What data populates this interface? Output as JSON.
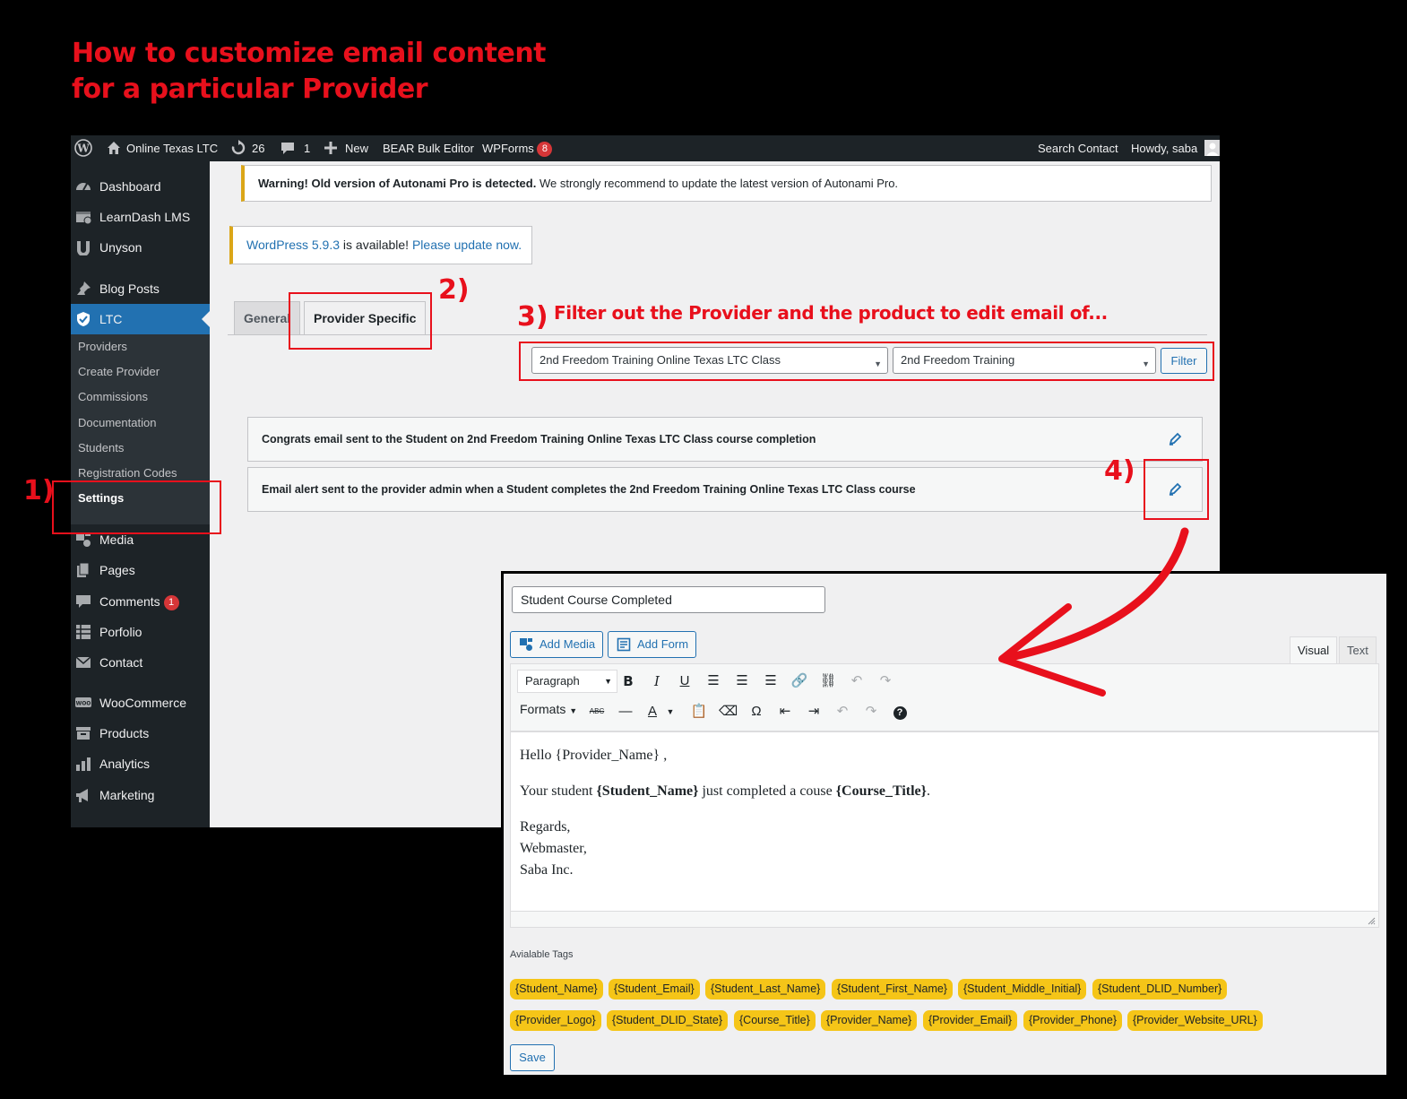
{
  "headline": {
    "line1": "How to customize email content",
    "line2": "for a particular Provider"
  },
  "annotations": {
    "step1": "1)",
    "step2": "2)",
    "step3": "3)",
    "step4": "4)",
    "step3_text": "Filter out the Provider and the product to edit email of..."
  },
  "adminbar": {
    "site_name": "Online Texas LTC",
    "updates_count": "26",
    "comments_count": "1",
    "new_label": "New",
    "bear_label": "BEAR Bulk Editor",
    "wpforms_label": "WPForms",
    "wpforms_badge": "8",
    "search_contact": "Search Contact",
    "howdy": "Howdy, saba"
  },
  "sidebar": {
    "items": [
      {
        "label": "Dashboard",
        "icon": "dashboard-icon"
      },
      {
        "label": "LearnDash LMS",
        "icon": "learndash-icon"
      },
      {
        "label": "Unyson",
        "icon": "unyson-icon"
      },
      {
        "label": "Blog Posts",
        "icon": "pin-icon"
      },
      {
        "label": "LTC",
        "icon": "shield-icon"
      },
      {
        "label": "Media",
        "icon": "media-icon"
      },
      {
        "label": "Pages",
        "icon": "pages-icon"
      },
      {
        "label": "Comments",
        "icon": "comment-icon",
        "badge": "1"
      },
      {
        "label": "Porfolio",
        "icon": "grid-icon"
      },
      {
        "label": "Contact",
        "icon": "mail-icon"
      },
      {
        "label": "WooCommerce",
        "icon": "woo-icon"
      },
      {
        "label": "Products",
        "icon": "archive-icon"
      },
      {
        "label": "Analytics",
        "icon": "bar-chart-icon"
      },
      {
        "label": "Marketing",
        "icon": "megaphone-icon"
      }
    ],
    "submenu": [
      "Providers",
      "Create Provider",
      "Commissions",
      "Documentation",
      "Students",
      "Registration Codes",
      "Settings"
    ]
  },
  "notices": {
    "warning_bold": "Warning! Old version of Autonami Pro is detected.",
    "warning_rest": " We strongly recommend to update the latest version of Autonami Pro.",
    "update_version": "WordPress 5.9.3",
    "update_middle": " is available! ",
    "update_link": "Please update now."
  },
  "tabs": {
    "general": "General",
    "provider_specific": "Provider Specific"
  },
  "filters": {
    "course_value": "2nd Freedom Training Online Texas LTC Class",
    "provider_value": "2nd Freedom Training",
    "filter_button": "Filter"
  },
  "email_rows": [
    "Congrats email sent to the Student on 2nd Freedom Training Online Texas LTC Class course completion",
    "Email alert sent to the provider admin when a Student completes the 2nd Freedom Training Online Texas LTC Class course"
  ],
  "editor": {
    "subject": "Student Course Completed",
    "add_media": "Add Media",
    "add_form": "Add Form",
    "visual_tab": "Visual",
    "text_tab": "Text",
    "paragraph": "Paragraph",
    "formats": "Formats",
    "body": {
      "greeting": "Hello {Provider_Name} ,",
      "line2_a": "Your student ",
      "line2_b": "{Student_Name}",
      "line2_c": " just completed a couse ",
      "line2_d": "{Course_Title}",
      "line2_e": ".",
      "regards": "Regards,",
      "sig1": "Webmaster,",
      "sig2": "Saba Inc."
    },
    "tags_title": "Avialable Tags",
    "tags_row1": [
      "{Student_Name}",
      "{Student_Email}",
      "{Student_Last_Name}",
      "{Student_First_Name}",
      "{Student_Middle_Initial}",
      "{Student_DLID_Number}"
    ],
    "tags_row2": [
      "{Provider_Logo}",
      "{Student_DLID_State}",
      "{Course_Title}",
      "{Provider_Name}",
      "{Provider_Email}",
      "{Provider_Phone}",
      "{Provider_Website_URL}"
    ],
    "save": "Save"
  },
  "colors": {
    "annotation_red": "#e8101c",
    "wp_blue": "#2271b1",
    "tag_yellow": "#f5c518"
  }
}
